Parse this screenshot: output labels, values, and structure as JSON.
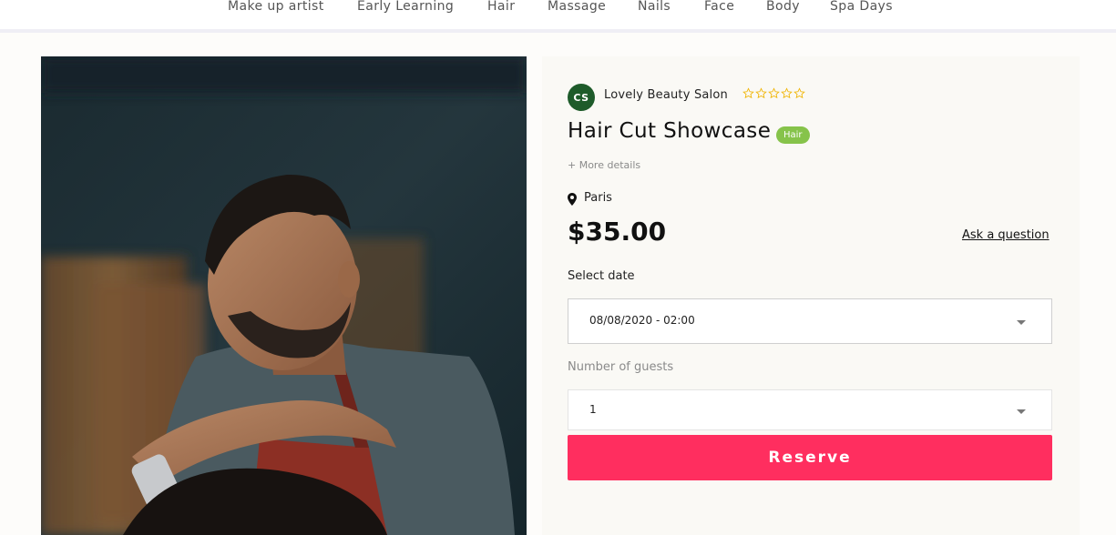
{
  "nav": {
    "items": [
      "Make up artist",
      "Early Learning",
      "Hair",
      "Massage",
      "Nails",
      "Face",
      "Body",
      "Spa Days"
    ]
  },
  "salon": {
    "initials": "CS",
    "name": "Lovely Beauty Salon",
    "rating": 0,
    "rating_max": 5,
    "star_color": "#f0b400",
    "avatar_color": "#1e5b2a"
  },
  "listing": {
    "title": "Hair Cut Showcase",
    "category_badge": "Hair",
    "badge_color": "#86c34a",
    "more_details": "+ More details",
    "location": "Paris",
    "price": "$35.00",
    "ask_link": "Ask a question"
  },
  "booking": {
    "date_label": "Select date",
    "date_value": "08/08/2020 - 02:00",
    "guests_label": "Number of guests",
    "guests_value": "1",
    "reserve_label": "Reserve",
    "reserve_color": "#ff2e5f"
  },
  "icons": {
    "location": "map-pin-icon",
    "caret": "chevron-down-icon",
    "star": "star-outline-icon"
  }
}
